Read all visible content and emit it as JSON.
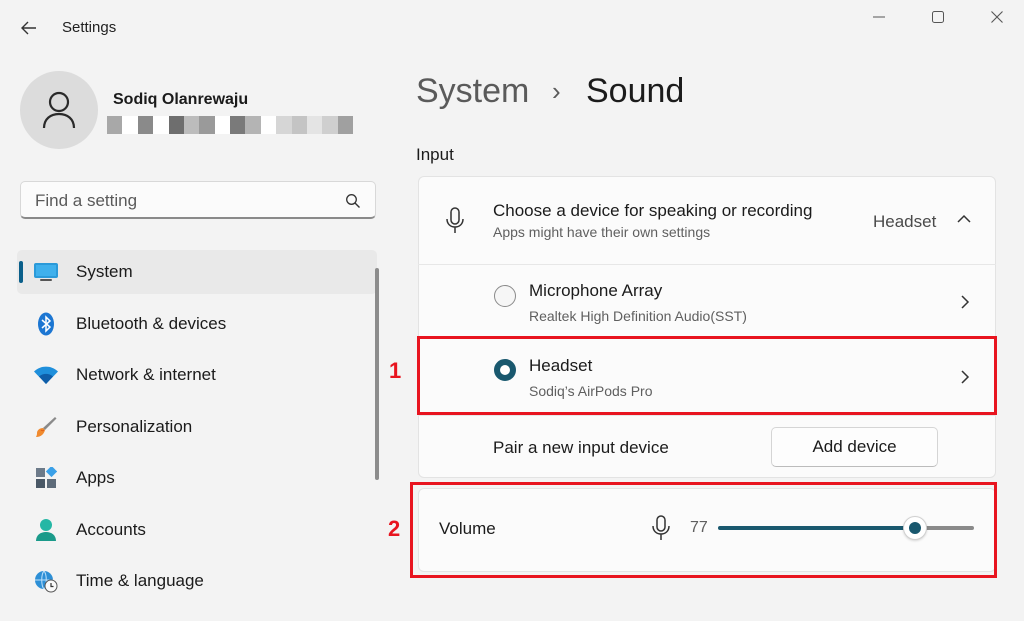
{
  "window": {
    "title": "Settings",
    "controls": [
      "minimize",
      "maximize",
      "close"
    ]
  },
  "profile": {
    "name": "Sodiq Olanrewaju",
    "email_redaction_colors": [
      "#a8a8a8",
      "#ffffff",
      "#8a8a8a",
      "#ffffff",
      "#6e6e6e",
      "#bcbcbc",
      "#9a9a9a",
      "#ffffff",
      "#7a7a7a",
      "#b4b4b4",
      "#ffffff",
      "#d6d6d6",
      "#c4c4c4",
      "#e4e4e4",
      "#cfcfcf",
      "#a0a0a0"
    ]
  },
  "search": {
    "placeholder": "Find a setting"
  },
  "sidebar": {
    "items": [
      {
        "label": "System",
        "icon": "monitor-icon",
        "active": true
      },
      {
        "label": "Bluetooth & devices",
        "icon": "bluetooth-icon",
        "active": false
      },
      {
        "label": "Network & internet",
        "icon": "wifi-icon",
        "active": false
      },
      {
        "label": "Personalization",
        "icon": "brush-icon",
        "active": false
      },
      {
        "label": "Apps",
        "icon": "apps-icon",
        "active": false
      },
      {
        "label": "Accounts",
        "icon": "person-icon",
        "active": false
      },
      {
        "label": "Time & language",
        "icon": "globe-clock-icon",
        "active": false
      }
    ]
  },
  "header": {
    "breadcrumb_parent": "System",
    "breadcrumb_separator": "›",
    "breadcrumb_current": "Sound"
  },
  "input_section": {
    "title": "Input",
    "chooser": {
      "title": "Choose a device for speaking or recording",
      "subtitle": "Apps might have their own settings",
      "selected": "Headset"
    },
    "devices": [
      {
        "name": "Microphone Array",
        "detail": "Realtek High Definition Audio(SST)",
        "selected": false
      },
      {
        "name": "Headset",
        "detail": "Sodiq’s AirPods Pro",
        "selected": true
      }
    ],
    "pair": {
      "label": "Pair a new input device",
      "button": "Add device"
    },
    "volume": {
      "label": "Volume",
      "value": "77",
      "percent": 77
    }
  },
  "annotations": {
    "one": "1",
    "two": "2",
    "color": "#e8141f"
  },
  "colors": {
    "accent": "#19586e",
    "background": "#f3f3f3",
    "card": "#fbfbfb"
  }
}
